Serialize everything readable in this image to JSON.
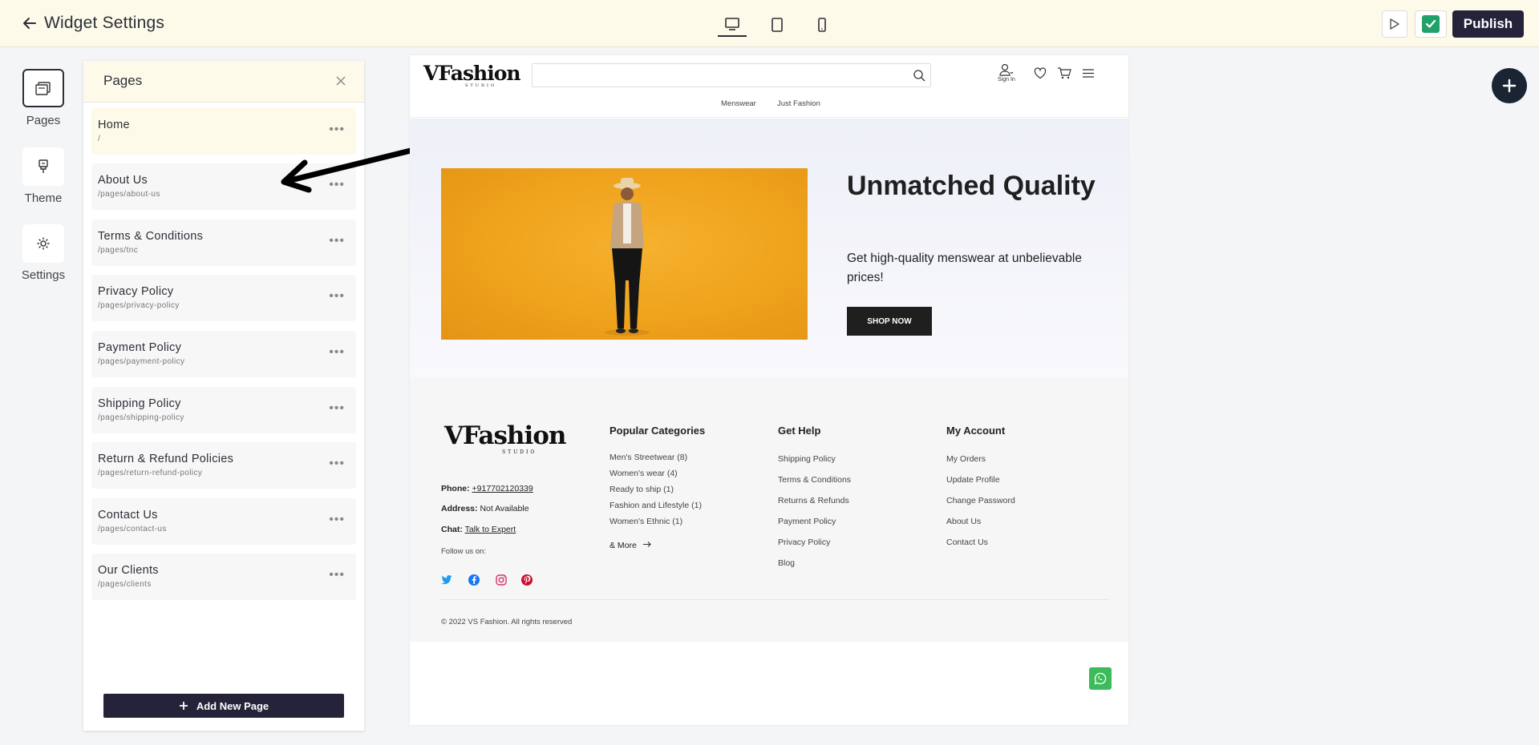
{
  "topbar": {
    "title": "Widget Settings",
    "publish_label": "Publish",
    "devices": [
      "desktop-icon",
      "tablet-icon",
      "mobile-icon"
    ]
  },
  "rail": {
    "pages_label": "Pages",
    "theme_label": "Theme",
    "settings_label": "Settings"
  },
  "panel": {
    "title": "Pages",
    "add_label": "Add New Page",
    "items": [
      {
        "name": "Home",
        "path": "/"
      },
      {
        "name": "About Us",
        "path": "/pages/about-us"
      },
      {
        "name": "Terms & Conditions",
        "path": "/pages/tnc"
      },
      {
        "name": "Privacy Policy",
        "path": "/pages/privacy-policy"
      },
      {
        "name": "Payment Policy",
        "path": "/pages/payment-policy"
      },
      {
        "name": "Shipping Policy",
        "path": "/pages/shipping-policy"
      },
      {
        "name": "Return & Refund Policies",
        "path": "/pages/return-refund-policy"
      },
      {
        "name": "Contact Us",
        "path": "/pages/contact-us"
      },
      {
        "name": "Our Clients",
        "path": "/pages/clients"
      }
    ]
  },
  "site": {
    "logo": "VFashion",
    "logo_sub": "STUDIO",
    "signin": "Sign In",
    "nav": [
      "Menswear",
      "Just Fashion"
    ],
    "hero": {
      "title": "Unmatched Quality",
      "subtitle": "Get high-quality menswear at unbelievable prices!",
      "cta": "SHOP NOW"
    },
    "footer": {
      "phone_label": "Phone:",
      "phone": "+917702120339",
      "address_label": "Address:",
      "address": "Not Available",
      "chat_label": "Chat:",
      "chat": "Talk to Expert",
      "follow": "Follow us on:",
      "popular_title": "Popular Categories",
      "popular": [
        "Men's Streetwear (8)",
        "Women's wear (4)",
        "Ready to ship (1)",
        "Fashion and Lifestyle (1)",
        "Women's Ethnic (1)"
      ],
      "more": "& More",
      "help_title": "Get Help",
      "help": [
        "Shipping Policy",
        "Terms & Conditions",
        "Returns & Refunds",
        "Payment Policy",
        "Privacy Policy",
        "Blog"
      ],
      "account_title": "My Account",
      "account": [
        "My Orders",
        "Update Profile",
        "Change Password",
        "About Us",
        "Contact Us"
      ],
      "copyright": "© 2022 VS Fashion. All rights reserved"
    }
  },
  "colors": {
    "topbar_bg": "#fdfaea",
    "dark": "#24233a",
    "accent_green": "#22a06b",
    "whatsapp": "#3dba59",
    "hero_orange": "#f0a520"
  }
}
